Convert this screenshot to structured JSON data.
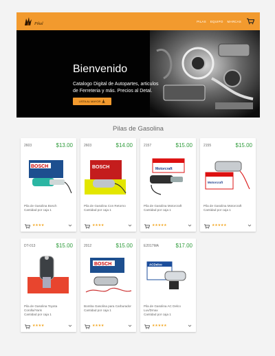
{
  "navbar": {
    "logo_text": "Pikal",
    "links": [
      "Pilas",
      "Equipo",
      "Marcas"
    ],
    "brand_color": "#f29a2e"
  },
  "hero": {
    "title": "Bienvenido",
    "subtitle": "Catalogo Digital de Autopartes, articulos de Ferreteria y más. Precios al Detal.",
    "button_label": "LISTA AL MAYOR"
  },
  "section": {
    "title": "Pilas de Gasolina"
  },
  "products": [
    {
      "code": "2603",
      "price": "$13.00",
      "name": "Pila de Gasolina Bosch",
      "qty": "Cantidad por caja 1",
      "rating": 4
    },
    {
      "code": "2603",
      "price": "$14.00",
      "name": "Pila de Gasolina Con Retorno",
      "qty": "Cantidad por caja 1",
      "rating": 4
    },
    {
      "code": "2157",
      "price": "$15.00",
      "name": "Pila de Gasolina Motorcraft",
      "qty": "Cantidad por caja 1",
      "rating": 5
    },
    {
      "code": "2155",
      "price": "$15.00",
      "name": "Pila de Gasolina Motorcraft",
      "qty": "Cantidad por caja 1",
      "rating": 5
    },
    {
      "code": "DT-013",
      "price": "$15.00",
      "name": "Pila de Gasolina Toyota Corolla/Yaris",
      "qty": "Cantidad por caja 1",
      "rating": 4
    },
    {
      "code": "2012",
      "price": "$15.00",
      "name": "Bomba Gasolina para Carburador",
      "qty": "Cantidad por caja 1",
      "rating": 4
    },
    {
      "code": "E2017MA",
      "price": "$17.00",
      "name": "Pila de Gasolina AC Delco Luv/Dmax",
      "qty": "Cantidad por caja 1",
      "rating": 5
    }
  ],
  "colors": {
    "price": "#2e9b3a",
    "stars": "#f2a621",
    "accent": "#f29a2e"
  },
  "icons": [
    "cart-icon",
    "download-icon",
    "add-to-cart-icon",
    "chevron-down-icon",
    "star-icon"
  ]
}
